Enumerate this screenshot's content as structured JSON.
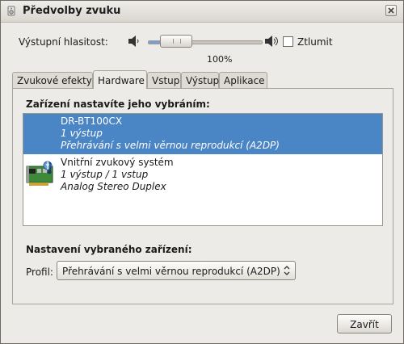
{
  "window": {
    "title": "Předvolby zvuku"
  },
  "volume": {
    "label": "Výstupní hlasitost:",
    "level_percent": 25,
    "percent_text": "100%",
    "mute_label": "Ztlumit",
    "mute_checked": false
  },
  "tabs": [
    {
      "label": "Zvukové efekty",
      "active": false
    },
    {
      "label": "Hardware",
      "active": true
    },
    {
      "label": "Vstup",
      "active": false
    },
    {
      "label": "Výstup",
      "active": false
    },
    {
      "label": "Aplikace",
      "active": false
    }
  ],
  "hardware": {
    "section_title": "Zařízení nastavíte jeho vybráním:",
    "devices": [
      {
        "name": "DR-BT100CX",
        "ports": "1 výstup",
        "profile": "Přehrávání s velmi věrnou reprodukcí (A2DP)",
        "selected": true,
        "icon": "bluetooth-icon"
      },
      {
        "name": "Vnitřní zvukový systém",
        "ports": "1 výstup / 1 vstup",
        "profile": "Analog Stereo Duplex",
        "selected": false,
        "icon": "sound-card-icon"
      }
    ],
    "settings_title": "Nastavení vybraného zařízení:",
    "profile_label": "Profil:",
    "profile_value": "Přehrávání s velmi věrnou reprodukcí (A2DP)"
  },
  "buttons": {
    "close": "Zavřít"
  },
  "colors": {
    "selection": "#4a86c6",
    "window_bg": "#edebe7"
  }
}
